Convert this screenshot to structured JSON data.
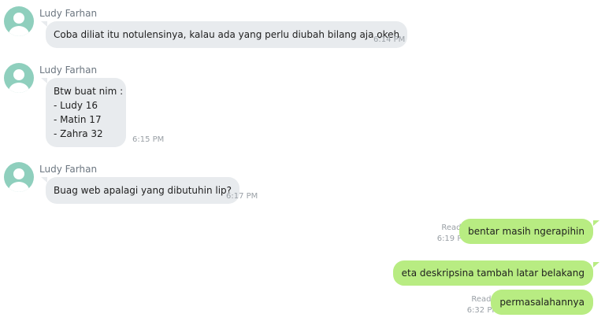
{
  "chat": {
    "incoming": [
      {
        "sender": "Ludy Farhan",
        "lines": [
          "Coba diliat itu notulensinya, kalau ada yang perlu diubah bilang aja okeh"
        ],
        "time": "6:14 PM"
      },
      {
        "sender": "Ludy Farhan",
        "lines": [
          "Btw buat nim :",
          "- Ludy 16",
          "- Matin 17",
          "- Zahra 32"
        ],
        "time": "6:15 PM"
      },
      {
        "sender": "Ludy Farhan",
        "lines": [
          "Buag web apalagi yang dibutuhin lip?"
        ],
        "time": "6:17 PM"
      }
    ],
    "outgoing": [
      {
        "text": "bentar masih ngerapihin",
        "read": "Read 3",
        "time": "6:19 PM"
      },
      {
        "text": "eta deskripsina tambah latar belakang",
        "read": "",
        "time": ""
      },
      {
        "text": "permasalahannya",
        "read": "Read 3",
        "time": "6:32 PM"
      }
    ]
  },
  "colors": {
    "incoming_bubble": "#e8ebee",
    "outgoing_bubble": "#b8ec82",
    "avatar": "#8fcfbd"
  },
  "icons": {
    "avatar": "default-user-icon"
  }
}
